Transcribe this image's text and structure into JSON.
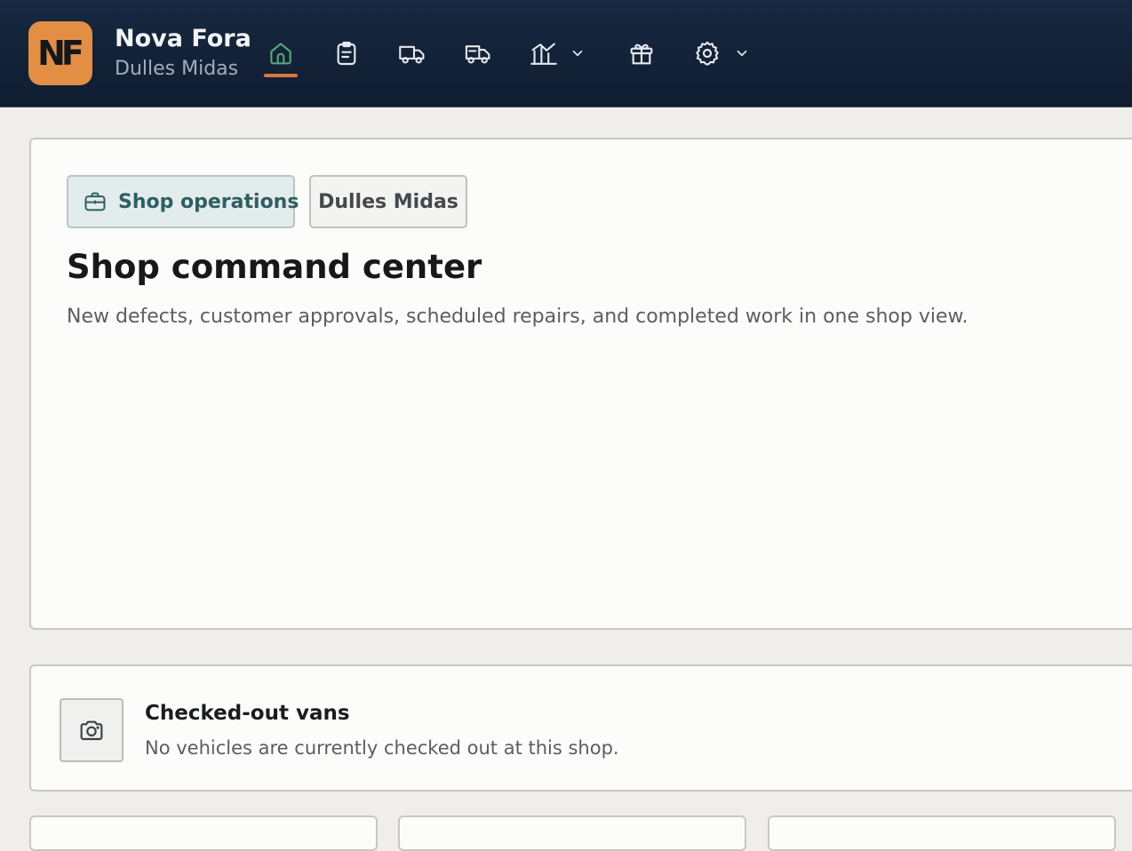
{
  "brand": {
    "logo_text": "NF",
    "name": "Nova Fora",
    "location": "Dulles Midas",
    "logo_color": "#e28e45"
  },
  "nav": {
    "items": [
      {
        "icon": "home-icon",
        "active": true
      },
      {
        "icon": "clipboard-icon",
        "active": false
      },
      {
        "icon": "truck-icon",
        "active": false
      },
      {
        "icon": "delivery-truck-icon",
        "active": false
      },
      {
        "icon": "analytics-icon",
        "active": false,
        "has_dropdown": true
      },
      {
        "icon": "gift-icon",
        "active": false
      },
      {
        "icon": "gear-icon",
        "active": false,
        "has_dropdown": true
      }
    ],
    "active_color": "#d9783c"
  },
  "hero": {
    "chips": [
      {
        "label": "Shop operations",
        "icon": "briefcase-icon",
        "selected": true
      },
      {
        "label": "Dulles Midas",
        "selected": false
      }
    ],
    "title": "Shop command center",
    "description": "New defects, customer approvals, scheduled repairs, and completed work in one shop view."
  },
  "checked_out_vans": {
    "icon": "camera-icon",
    "title": "Checked-out vans",
    "description": "No vehicles are currently checked out at this shop."
  },
  "colors": {
    "topbar": "#132339",
    "accent_teal": "#2f5e62",
    "page_bg": "#efeeeb"
  }
}
